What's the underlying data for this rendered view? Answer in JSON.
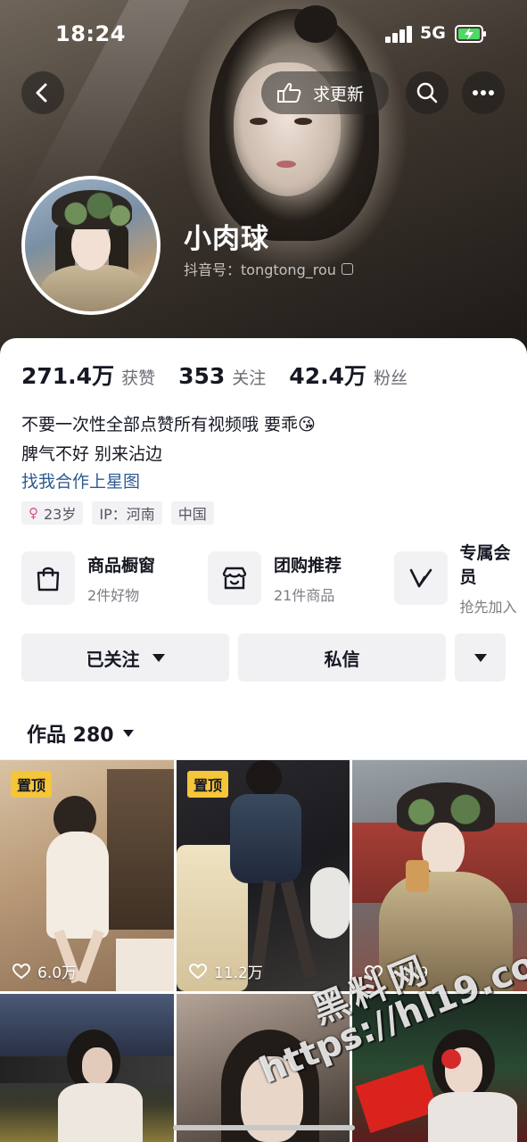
{
  "status_bar": {
    "time": "18:24",
    "network": "5G"
  },
  "top_bar": {
    "request_update_label": "求更新"
  },
  "profile": {
    "nickname": "小肉球",
    "douyin_id": "抖音号：tongtong_rou"
  },
  "stats": [
    {
      "value": "271.4万",
      "label": "获赞"
    },
    {
      "value": "353",
      "label": "关注"
    },
    {
      "value": "42.4万",
      "label": "粉丝"
    }
  ],
  "bio": {
    "line1": "不要一次性全部点赞所有视频哦 要乖😘",
    "line2": "脾气不好 别来沾边",
    "link": "找我合作上星图"
  },
  "tags": {
    "gender_symbol": "♀",
    "age": "23岁",
    "ip": "IP：河南",
    "country": "中国"
  },
  "services": [
    {
      "title": "商品橱窗",
      "subtitle": "2件好物",
      "icon": "shopping-bag-icon"
    },
    {
      "title": "团购推荐",
      "subtitle": "21件商品",
      "icon": "store-icon"
    },
    {
      "title": "专属会员",
      "subtitle": "抢先加入",
      "icon": "membership-v-icon"
    }
  ],
  "actions": {
    "follow_label": "已关注",
    "message_label": "私信"
  },
  "works": {
    "label": "作品 280"
  },
  "grid": [
    {
      "pinned": true,
      "pin_label": "置顶",
      "likes": "6.0万"
    },
    {
      "pinned": true,
      "pin_label": "置顶",
      "likes": "11.2万"
    },
    {
      "pinned": false,
      "likes": "5449"
    },
    {
      "pinned": false
    },
    {
      "pinned": false
    },
    {
      "pinned": false
    }
  ],
  "watermark": {
    "title": "黑料网",
    "url": "https://hl19.co"
  },
  "colors": {
    "pin": "#f5c53a",
    "link": "#2f5a8f",
    "gender": "#e5488c",
    "battery": "#4cd964"
  }
}
